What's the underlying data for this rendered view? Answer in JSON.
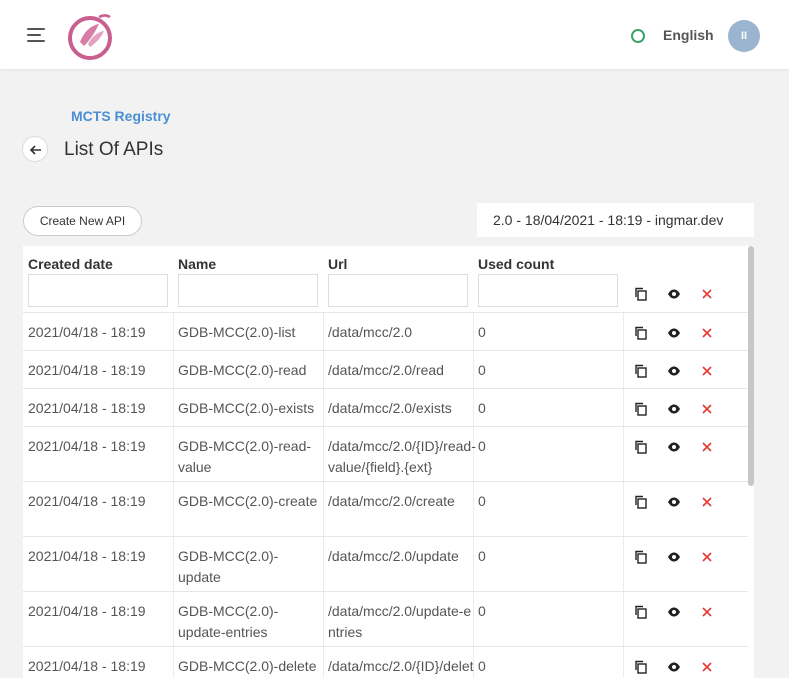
{
  "header": {
    "language": "English",
    "avatar_initials": "II"
  },
  "breadcrumb": "MCTS Registry",
  "page_title": "List Of APIs",
  "toolbar": {
    "create_label": "Create New API",
    "version_info": "2.0 - 18/04/2021 - 18:19 - ingmar.dev"
  },
  "table": {
    "columns": [
      "Created date",
      "Name",
      "Url",
      "Used count"
    ],
    "rows": [
      {
        "created": "2021/04/18 - 18:19",
        "name": "GDB-MCC(2.0)-list",
        "url": "/data/mcc/2.0",
        "count": "0"
      },
      {
        "created": "2021/04/18 - 18:19",
        "name": "GDB-MCC(2.0)-read",
        "url": "/data/mcc/2.0/read",
        "count": "0"
      },
      {
        "created": "2021/04/18 - 18:19",
        "name": "GDB-MCC(2.0)-exists",
        "url": "/data/mcc/2.0/exists",
        "count": "0"
      },
      {
        "created": "2021/04/18 - 18:19",
        "name": "GDB-MCC(2.0)-read-value",
        "url": "/data/mcc/2.0/{ID}/read-value/{field}.{ext}",
        "count": "0"
      },
      {
        "created": "2021/04/18 - 18:19",
        "name": "GDB-MCC(2.0)-create",
        "url": "/data/mcc/2.0/create",
        "count": "0"
      },
      {
        "created": "2021/04/18 - 18:19",
        "name": "GDB-MCC(2.0)-update",
        "url": "/data/mcc/2.0/update",
        "count": "0"
      },
      {
        "created": "2021/04/18 - 18:19",
        "name": "GDB-MCC(2.0)-update-entries",
        "url": "/data/mcc/2.0/update-entries",
        "count": "0"
      },
      {
        "created": "2021/04/18 - 18:19",
        "name": "GDB-MCC(2.0)-delete",
        "url": "/data/mcc/2.0/{ID}/delet",
        "count": "0"
      }
    ]
  },
  "colors": {
    "accent": "#4a8fd4",
    "delete": "#e53935",
    "status": "#3aa26b",
    "avatar": "#9bb4d0",
    "logo": "#c95f8f"
  }
}
